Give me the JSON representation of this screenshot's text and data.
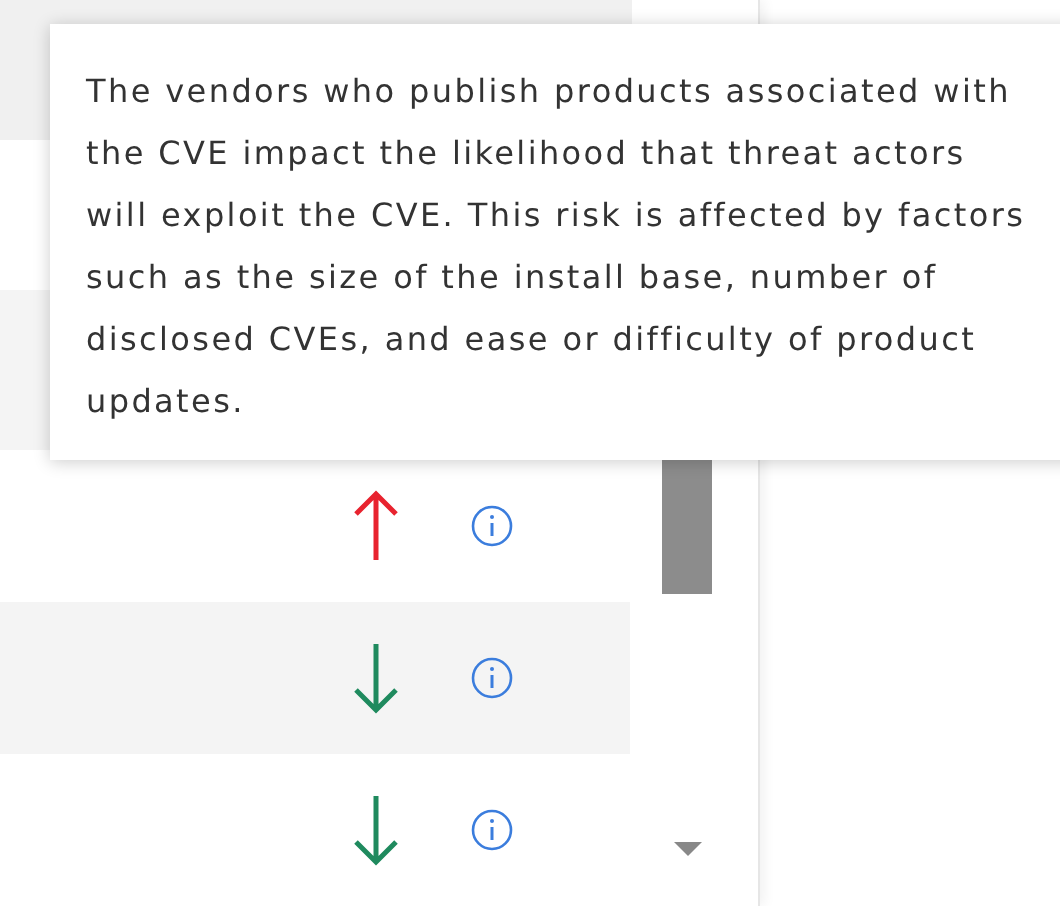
{
  "tooltip": {
    "text": "The vendors who publish products associated with the CVE impact the likelihood that threat actors will exploit the CVE. This risk is affected by factors such as the size of the install base, number of disclosed CVEs, and ease or difficulty of product updates."
  },
  "rows": [
    {
      "kind": "up"
    },
    {
      "kind": "down"
    },
    {
      "kind": "down"
    }
  ]
}
